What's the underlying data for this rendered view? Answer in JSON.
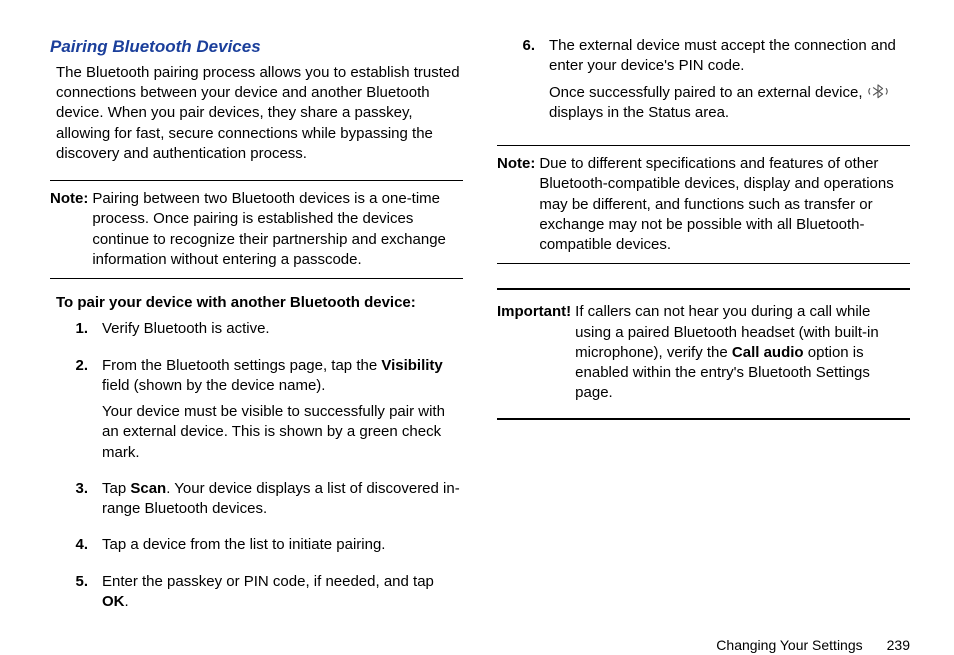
{
  "section_title": "Pairing Bluetooth Devices",
  "intro": "The Bluetooth pairing process allows you to establish trusted connections between your device and another Bluetooth device. When you pair devices, they share a passkey, allowing for fast, secure connections while bypassing the discovery and authentication process.",
  "note1": {
    "label": "Note:",
    "body": "Pairing between two Bluetooth devices is a one-time process. Once pairing is established the devices continue to recognize their partnership and exchange information without entering a passcode."
  },
  "subhead": "To pair your device with another Bluetooth device:",
  "steps": {
    "s1": {
      "p1": "Verify Bluetooth is active."
    },
    "s2": {
      "p1_a": "From the Bluetooth settings page, tap the ",
      "p1_bold": "Visibility",
      "p1_b": " field (shown by the device name).",
      "p2": "Your device must be visible to successfully pair with an external device. This is shown by a green check mark."
    },
    "s3": {
      "p1_a": "Tap ",
      "p1_bold": "Scan",
      "p1_b": ". Your device displays a list of discovered in-range Bluetooth devices."
    },
    "s4": {
      "p1": "Tap a device from the list to initiate pairing."
    },
    "s5": {
      "p1_a": "Enter the passkey or PIN code, if needed, and tap ",
      "p1_bold": "OK",
      "p1_b": "."
    },
    "s6": {
      "p1": "The external device must accept the connection and enter your device's PIN code.",
      "p2_a": "Once successfully paired to an external device, ",
      "p2_b": " displays in the Status area."
    }
  },
  "note2": {
    "label": "Note:",
    "body": "Due to different specifications and features of other Bluetooth-compatible devices, display and operations may be different, and functions such as transfer or exchange may not be possible with all Bluetooth-compatible devices."
  },
  "important": {
    "label": "Important!",
    "body_a": "If callers can not hear you during a call while using a paired Bluetooth headset (with built-in microphone), verify the ",
    "body_bold": "Call audio",
    "body_b": " option is enabled within the entry's Bluetooth Settings page."
  },
  "footer": {
    "chapter": "Changing Your Settings",
    "page": "239"
  },
  "icons": {
    "bluetooth_connected": "bluetooth-connected-icon"
  }
}
